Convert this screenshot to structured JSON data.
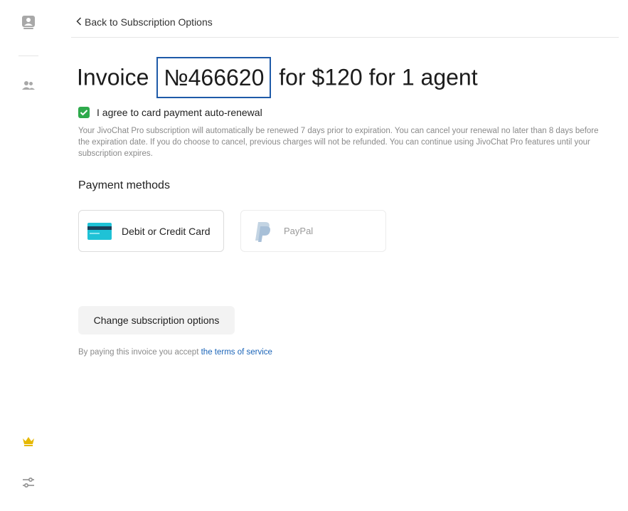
{
  "nav": {
    "back_label": "Back to Subscription Options"
  },
  "invoice": {
    "prefix": "Invoice ",
    "number": "№466620",
    "suffix": " for $120 for 1 agent"
  },
  "agreement": {
    "checked": true,
    "label": "I agree to card payment auto-renewal",
    "note": "Your JivoChat Pro subscription will automatically be renewed 7 days prior to expiration. You can cancel your renewal no later than 8 days before the expiration date. If you do choose to cancel, previous charges will not be refunded. You can continue using JivoChat Pro features until your subscription expires."
  },
  "payment": {
    "title": "Payment methods",
    "methods": [
      {
        "label": "Debit or Credit Card",
        "icon": "credit-card-icon"
      },
      {
        "label": "PayPal",
        "icon": "paypal-icon"
      }
    ]
  },
  "actions": {
    "change_label": "Change subscription options"
  },
  "terms": {
    "text": "By paying this invoice you accept ",
    "link": "the terms of service"
  },
  "colors": {
    "accent": "#1a64b8",
    "check": "#2eaa4c",
    "crown": "#e6b800",
    "highlight": "#1e5aa8"
  }
}
